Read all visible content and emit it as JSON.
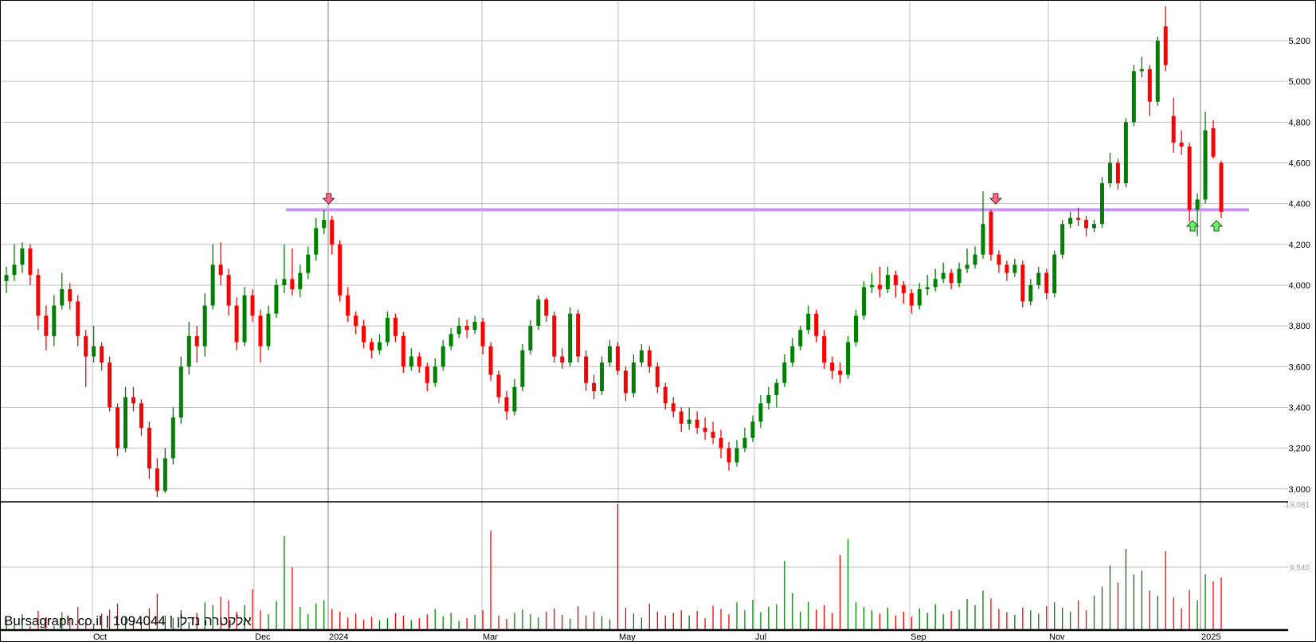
{
  "watermark": "Bursagraph.co.il | 1094044 | אלקטרה נדלן",
  "chart_data": {
    "type": "candlestick",
    "title": "",
    "colors": {
      "up": "#008000",
      "down": "#ff0000",
      "support_line": "#c896f8",
      "sell_arrow": "#ff6680",
      "buy_arrow": "#66ff66"
    },
    "ylim": [
      2900,
      5400
    ],
    "y_ticks": [
      3000,
      3200,
      3400,
      3600,
      3800,
      4000,
      4200,
      4400,
      4600,
      4800,
      5000,
      5200
    ],
    "y_tick_labels": [
      "3,000",
      "3,200",
      "3,400",
      "3,600",
      "3,800",
      "4,000",
      "4,200",
      "4,400",
      "4,600",
      "4,800",
      "5,000",
      "5,200"
    ],
    "x_tick_labels": [
      "Oct",
      "Dec",
      "2024",
      "Mar",
      "May",
      "Jul",
      "Sep",
      "Nov",
      "2025"
    ],
    "grid": true,
    "support_level": 4370,
    "signals": [
      {
        "type": "sell",
        "index": 40
      },
      {
        "type": "sell",
        "index": 124
      },
      {
        "type": "buy",
        "index": 149
      },
      {
        "type": "buy",
        "index": 152
      }
    ],
    "ohlc": [
      [
        4020,
        4090,
        3960,
        4050
      ],
      [
        4050,
        4200,
        4020,
        4100
      ],
      [
        4100,
        4210,
        4060,
        4180
      ],
      [
        4180,
        4200,
        4000,
        4050
      ],
      [
        4050,
        4080,
        3780,
        3850
      ],
      [
        3850,
        3900,
        3680,
        3750
      ],
      [
        3750,
        3950,
        3700,
        3900
      ],
      [
        3900,
        4060,
        3880,
        3980
      ],
      [
        3980,
        4010,
        3880,
        3920
      ],
      [
        3920,
        3950,
        3700,
        3750
      ],
      [
        3750,
        3780,
        3500,
        3650
      ],
      [
        3650,
        3800,
        3620,
        3700
      ],
      [
        3700,
        3720,
        3580,
        3620
      ],
      [
        3620,
        3650,
        3380,
        3400
      ],
      [
        3400,
        3420,
        3160,
        3200
      ],
      [
        3200,
        3500,
        3180,
        3450
      ],
      [
        3450,
        3500,
        3380,
        3420
      ],
      [
        3420,
        3440,
        3260,
        3300
      ],
      [
        3300,
        3330,
        3050,
        3100
      ],
      [
        3100,
        3150,
        2960,
        2990
      ],
      [
        2990,
        3200,
        2980,
        3150
      ],
      [
        3150,
        3400,
        3120,
        3350
      ],
      [
        3350,
        3650,
        3320,
        3600
      ],
      [
        3600,
        3820,
        3560,
        3750
      ],
      [
        3750,
        3800,
        3620,
        3700
      ],
      [
        3700,
        3960,
        3650,
        3900
      ],
      [
        3900,
        4200,
        3880,
        4100
      ],
      [
        4100,
        4210,
        4000,
        4050
      ],
      [
        4050,
        4080,
        3850,
        3900
      ],
      [
        3900,
        3940,
        3680,
        3720
      ],
      [
        3720,
        3990,
        3700,
        3950
      ],
      [
        3950,
        3980,
        3820,
        3850
      ],
      [
        3850,
        3880,
        3620,
        3700
      ],
      [
        3700,
        3900,
        3680,
        3860
      ],
      [
        3860,
        4030,
        3840,
        4000
      ],
      [
        4000,
        4200,
        3960,
        4030
      ],
      [
        4030,
        4180,
        3950,
        3980
      ],
      [
        3980,
        4100,
        3940,
        4060
      ],
      [
        4060,
        4190,
        4030,
        4150
      ],
      [
        4150,
        4330,
        4120,
        4280
      ],
      [
        4280,
        4370,
        4250,
        4320
      ],
      [
        4320,
        4340,
        4150,
        4200
      ],
      [
        4200,
        4220,
        3920,
        3950
      ],
      [
        3950,
        3990,
        3820,
        3850
      ],
      [
        3850,
        3870,
        3760,
        3800
      ],
      [
        3800,
        3830,
        3690,
        3720
      ],
      [
        3720,
        3740,
        3640,
        3680
      ],
      [
        3680,
        3760,
        3660,
        3720
      ],
      [
        3720,
        3870,
        3700,
        3840
      ],
      [
        3840,
        3860,
        3720,
        3750
      ],
      [
        3750,
        3770,
        3570,
        3600
      ],
      [
        3600,
        3690,
        3580,
        3650
      ],
      [
        3650,
        3670,
        3570,
        3600
      ],
      [
        3600,
        3620,
        3480,
        3520
      ],
      [
        3520,
        3640,
        3500,
        3600
      ],
      [
        3600,
        3730,
        3580,
        3700
      ],
      [
        3700,
        3790,
        3680,
        3760
      ],
      [
        3760,
        3840,
        3740,
        3800
      ],
      [
        3800,
        3830,
        3740,
        3780
      ],
      [
        3780,
        3850,
        3760,
        3820
      ],
      [
        3820,
        3840,
        3660,
        3700
      ],
      [
        3700,
        3720,
        3530,
        3560
      ],
      [
        3560,
        3580,
        3420,
        3450
      ],
      [
        3450,
        3480,
        3340,
        3380
      ],
      [
        3380,
        3540,
        3360,
        3500
      ],
      [
        3500,
        3710,
        3480,
        3680
      ],
      [
        3680,
        3830,
        3660,
        3800
      ],
      [
        3800,
        3950,
        3780,
        3930
      ],
      [
        3930,
        3940,
        3820,
        3850
      ],
      [
        3850,
        3870,
        3620,
        3650
      ],
      [
        3650,
        3690,
        3590,
        3620
      ],
      [
        3620,
        3890,
        3600,
        3860
      ],
      [
        3860,
        3880,
        3620,
        3650
      ],
      [
        3650,
        3680,
        3480,
        3520
      ],
      [
        3520,
        3560,
        3440,
        3480
      ],
      [
        3480,
        3650,
        3460,
        3620
      ],
      [
        3620,
        3730,
        3600,
        3700
      ],
      [
        3700,
        3720,
        3560,
        3580
      ],
      [
        3580,
        3600,
        3430,
        3470
      ],
      [
        3470,
        3660,
        3450,
        3620
      ],
      [
        3620,
        3710,
        3600,
        3680
      ],
      [
        3680,
        3700,
        3570,
        3600
      ],
      [
        3600,
        3620,
        3470,
        3500
      ],
      [
        3500,
        3520,
        3390,
        3420
      ],
      [
        3420,
        3450,
        3350,
        3380
      ],
      [
        3380,
        3400,
        3280,
        3320
      ],
      [
        3320,
        3400,
        3290,
        3340
      ],
      [
        3340,
        3380,
        3270,
        3300
      ],
      [
        3300,
        3350,
        3240,
        3280
      ],
      [
        3280,
        3330,
        3220,
        3250
      ],
      [
        3250,
        3290,
        3150,
        3200
      ],
      [
        3200,
        3230,
        3090,
        3130
      ],
      [
        3130,
        3240,
        3110,
        3200
      ],
      [
        3200,
        3300,
        3180,
        3250
      ],
      [
        3250,
        3360,
        3230,
        3330
      ],
      [
        3330,
        3460,
        3300,
        3420
      ],
      [
        3420,
        3500,
        3390,
        3460
      ],
      [
        3460,
        3540,
        3400,
        3520
      ],
      [
        3520,
        3660,
        3500,
        3620
      ],
      [
        3620,
        3740,
        3600,
        3700
      ],
      [
        3700,
        3800,
        3680,
        3780
      ],
      [
        3780,
        3900,
        3760,
        3860
      ],
      [
        3860,
        3880,
        3720,
        3750
      ],
      [
        3750,
        3780,
        3590,
        3620
      ],
      [
        3620,
        3650,
        3540,
        3580
      ],
      [
        3580,
        3620,
        3520,
        3560
      ],
      [
        3560,
        3750,
        3540,
        3720
      ],
      [
        3720,
        3880,
        3700,
        3850
      ],
      [
        3850,
        4020,
        3830,
        3990
      ],
      [
        3990,
        4060,
        3960,
        4000
      ],
      [
        4000,
        4090,
        3940,
        3980
      ],
      [
        3980,
        4090,
        3960,
        4050
      ],
      [
        4050,
        4070,
        3940,
        4000
      ],
      [
        4000,
        4020,
        3910,
        3960
      ],
      [
        3960,
        3980,
        3860,
        3900
      ],
      [
        3900,
        4010,
        3880,
        3980
      ],
      [
        3980,
        4050,
        3950,
        3990
      ],
      [
        3990,
        4080,
        3970,
        4030
      ],
      [
        4030,
        4110,
        4010,
        4060
      ],
      [
        4060,
        4080,
        3980,
        4010
      ],
      [
        4010,
        4110,
        3990,
        4080
      ],
      [
        4080,
        4180,
        4060,
        4100
      ],
      [
        4100,
        4190,
        4080,
        4150
      ],
      [
        4150,
        4460,
        4130,
        4300
      ],
      [
        4360,
        4370,
        4120,
        4150
      ],
      [
        4150,
        4170,
        4060,
        4100
      ],
      [
        4100,
        4120,
        4020,
        4060
      ],
      [
        4060,
        4130,
        4040,
        4100
      ],
      [
        4100,
        4120,
        3890,
        3920
      ],
      [
        3920,
        4030,
        3900,
        4000
      ],
      [
        4000,
        4090,
        3980,
        4060
      ],
      [
        4060,
        4080,
        3930,
        3960
      ],
      [
        3960,
        4170,
        3940,
        4150
      ],
      [
        4150,
        4320,
        4130,
        4300
      ],
      [
        4300,
        4360,
        4280,
        4330
      ],
      [
        4330,
        4380,
        4290,
        4320
      ],
      [
        4320,
        4340,
        4240,
        4280
      ],
      [
        4280,
        4320,
        4260,
        4300
      ],
      [
        4300,
        4530,
        4280,
        4500
      ],
      [
        4500,
        4650,
        4480,
        4600
      ],
      [
        4600,
        4620,
        4470,
        4500
      ],
      [
        4500,
        4820,
        4480,
        4800
      ],
      [
        4800,
        5080,
        4780,
        5050
      ],
      [
        5050,
        5120,
        5020,
        5060
      ],
      [
        5060,
        5080,
        4830,
        4900
      ],
      [
        4900,
        5220,
        4880,
        5200
      ],
      [
        5270,
        5370,
        5050,
        5080
      ],
      [
        4830,
        4920,
        4650,
        4700
      ],
      [
        4700,
        4760,
        4640,
        4680
      ],
      [
        4680,
        4700,
        4310,
        4370
      ],
      [
        4370,
        4450,
        4240,
        4420
      ],
      [
        4420,
        4850,
        4400,
        4760
      ],
      [
        4770,
        4810,
        4620,
        4630
      ],
      [
        4600,
        4610,
        4330,
        4360
      ]
    ],
    "volume": {
      "y_ticks": [
        9540,
        19081
      ],
      "y_tick_labels": [
        "9,540",
        "19,081"
      ],
      "values": [
        1500,
        800,
        2400,
        600,
        2900,
        2000,
        600,
        2700,
        1800,
        3500,
        1200,
        700,
        2500,
        3100,
        4000,
        2000,
        1500,
        900,
        3300,
        5500,
        2200,
        1800,
        3000,
        1200,
        2600,
        4200,
        3800,
        5000,
        4500,
        2800,
        3800,
        6200,
        3000,
        2400,
        4400,
        14250,
        9500,
        3500,
        2400,
        4000,
        4500,
        3200,
        2800,
        1900,
        2500,
        1600,
        2000,
        1500,
        1800,
        2600,
        2200,
        1500,
        1800,
        2400,
        3200,
        2100,
        2600,
        1400,
        1800,
        2300,
        3000,
        15100,
        2200,
        1700,
        2600,
        3100,
        2400,
        1900,
        2800,
        3300,
        2300,
        1700,
        3600,
        2200,
        2800,
        2100,
        1600,
        19081,
        3400,
        2500,
        1900,
        4000,
        2800,
        2200,
        2600,
        3000,
        2200,
        2900,
        1800,
        3700,
        3200,
        2400,
        4200,
        3000,
        4600,
        2700,
        3500,
        3900,
        10500,
        5600,
        2800,
        4300,
        3100,
        3800,
        2600,
        11350,
        13770,
        4200,
        3500,
        3000,
        2500,
        3400,
        2200,
        2800,
        2000,
        3300,
        2600,
        3900,
        2400,
        2900,
        3100,
        4700,
        3800,
        6000,
        4800,
        3200,
        2700,
        2300,
        3400,
        3000,
        2500,
        3600,
        4200,
        3400,
        2800,
        4500,
        3000,
        5200,
        6600,
        9800,
        7200,
        12300,
        8400,
        9000,
        6000,
        5200,
        11950,
        5000,
        3300,
        6100,
        4500,
        8450,
        7370,
        7970
      ]
    }
  }
}
